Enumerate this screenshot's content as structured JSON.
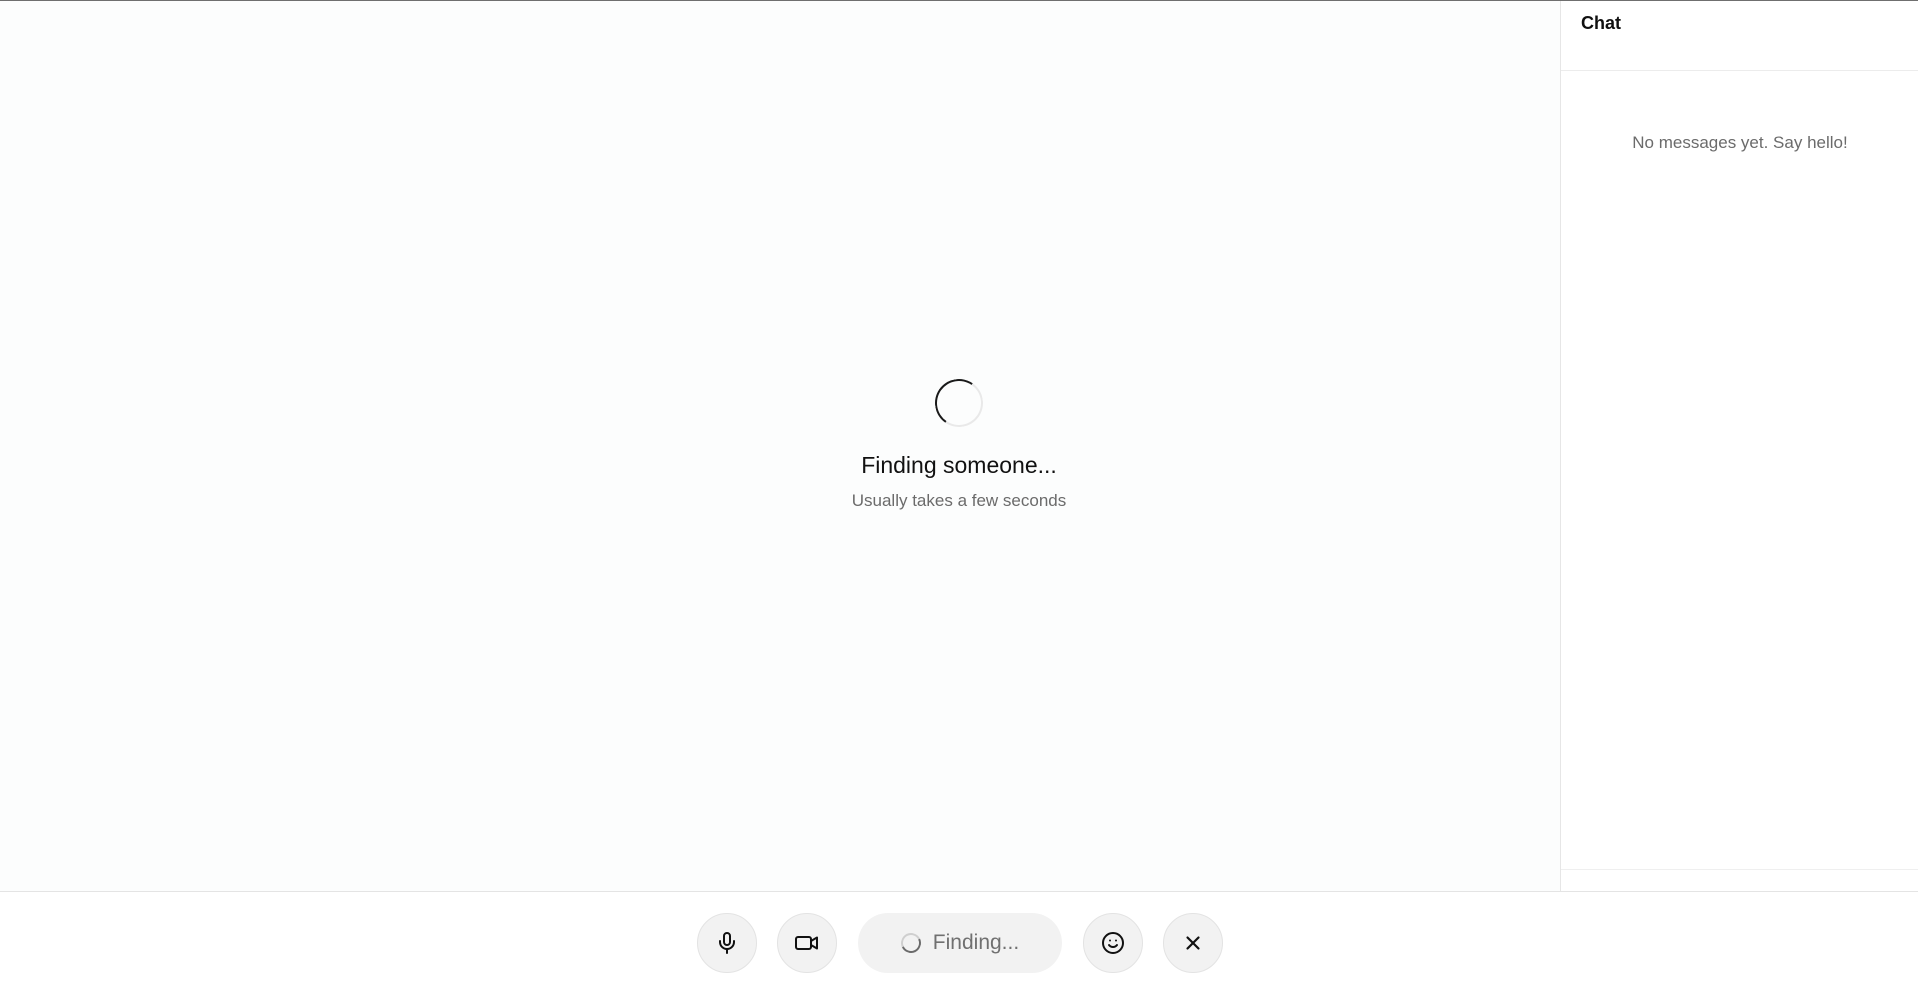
{
  "stage": {
    "status_title": "Finding someone...",
    "status_subtitle": "Usually takes a few seconds"
  },
  "chat": {
    "title": "Chat",
    "empty_message": "No messages yet. Say hello!"
  },
  "toolbar": {
    "mic_icon": "microphone-icon",
    "camera_icon": "video-camera-icon",
    "finding_label": "Finding...",
    "emoji_icon": "smiley-icon",
    "close_icon": "close-icon"
  },
  "colors": {
    "text_primary": "#111111",
    "text_muted": "#6b6b6b",
    "button_bg": "#f2f2f2"
  }
}
